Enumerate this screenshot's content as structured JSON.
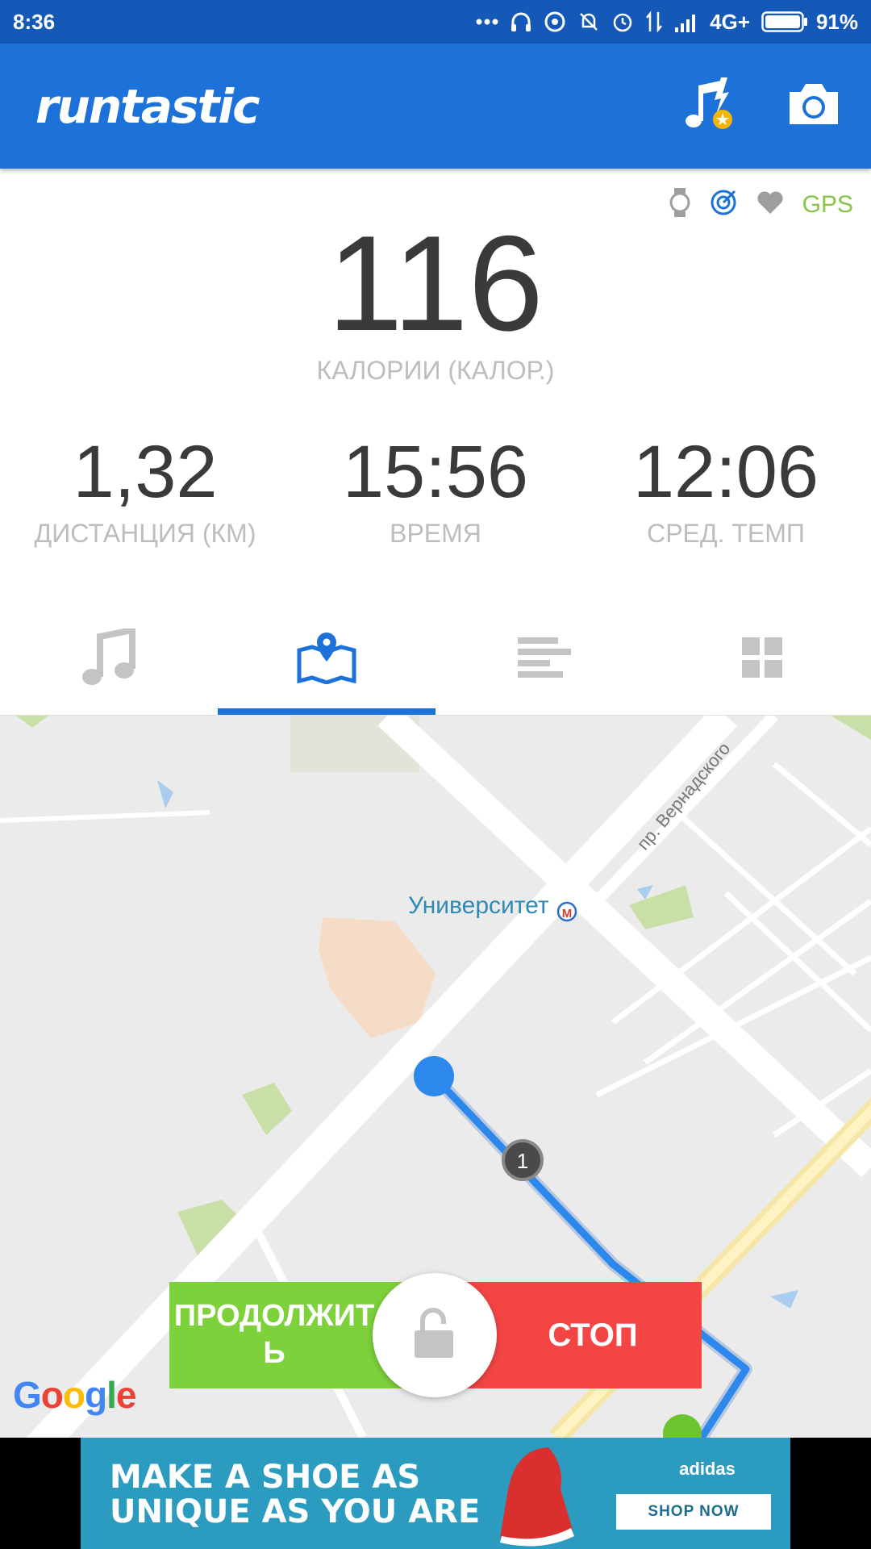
{
  "status_bar": {
    "time": "8:36",
    "network": "4G+",
    "battery": "91%"
  },
  "app_bar": {
    "title": "runtastic",
    "icons": [
      "music-boost-icon",
      "camera-icon"
    ]
  },
  "sensors": {
    "icons": [
      "watch-icon",
      "target-icon",
      "heart-icon"
    ],
    "gps_label": "GPS"
  },
  "stats": {
    "main": {
      "value": "116",
      "label": "КАЛОРИИ (КАЛОР.)"
    },
    "distance": {
      "value": "1,32",
      "label": "ДИСТАНЦИЯ (КМ)"
    },
    "time": {
      "value": "15:56",
      "label": "ВРЕМЯ"
    },
    "pace": {
      "value": "12:06",
      "label": "СРЕД. ТЕМП"
    }
  },
  "tabs": [
    {
      "icon": "music-note-icon",
      "active": false
    },
    {
      "icon": "map-icon",
      "active": true
    },
    {
      "icon": "bars-icon",
      "active": false
    },
    {
      "icon": "grid-icon",
      "active": false
    }
  ],
  "map": {
    "street_label": "пр. Вернадского",
    "station_label": "Университет",
    "metro_letter": "М",
    "split_marker": "1",
    "attribution": "Google"
  },
  "controls": {
    "continue_label": "ПРОДОЛЖИТЬ",
    "continue_line1": "ПРОДОЛЖИТ",
    "continue_line2": "Ь",
    "stop_label": "СТОП"
  },
  "ad": {
    "line1": "MAKE A SHOE AS",
    "line2": "UNIQUE AS YOU ARE",
    "brand": "adidas",
    "cta": "SHOP NOW"
  },
  "colors": {
    "status_bar": "#1458b8",
    "app_bar": "#1c72d8",
    "accent": "#1c72d8",
    "gps": "#8ac34a",
    "continue": "#7dd13a",
    "stop": "#f44545",
    "ad_bg": "#2b9cc0"
  }
}
